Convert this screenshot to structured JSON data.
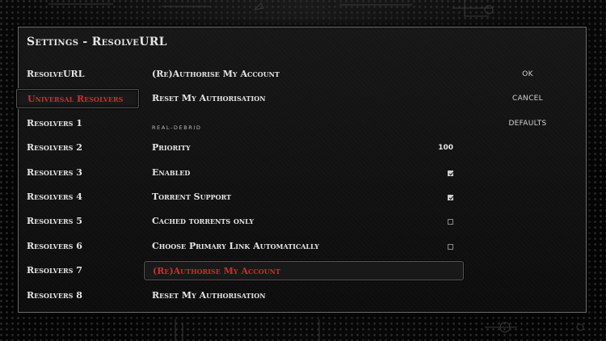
{
  "dialog": {
    "title": "Settings - ResolveURL"
  },
  "categories": [
    {
      "label": "ResolveURL",
      "active": false
    },
    {
      "label": "Universal Resolvers",
      "active": true
    },
    {
      "label": "Resolvers 1",
      "active": false
    },
    {
      "label": "Resolvers 2",
      "active": false
    },
    {
      "label": "Resolvers 3",
      "active": false
    },
    {
      "label": "Resolvers 4",
      "active": false
    },
    {
      "label": "Resolvers 5",
      "active": false
    },
    {
      "label": "Resolvers 6",
      "active": false
    },
    {
      "label": "Resolvers 7",
      "active": false
    },
    {
      "label": "Resolvers 8",
      "active": false
    }
  ],
  "settings": {
    "reauthorise_top": "(Re)Authorise My Account",
    "reset_top": "Reset My Authorisation",
    "section_label": "REAL-DEBRID",
    "priority": {
      "label": "Priority",
      "value": "100"
    },
    "enabled": {
      "label": "Enabled",
      "checked": true
    },
    "torrent_support": {
      "label": "Torrent Support",
      "checked": true
    },
    "cached_only": {
      "label": "Cached torrents only",
      "checked": false
    },
    "choose_primary": {
      "label": "Choose Primary Link Automatically",
      "checked": false
    },
    "reauthorise": "(Re)Authorise My Account",
    "reset": "Reset My Authorisation"
  },
  "buttons": {
    "ok": "OK",
    "cancel": "CANCEL",
    "defaults": "DEFAULTS"
  },
  "colors": {
    "accent": "#c8312e",
    "text": "#e6e6e6"
  }
}
